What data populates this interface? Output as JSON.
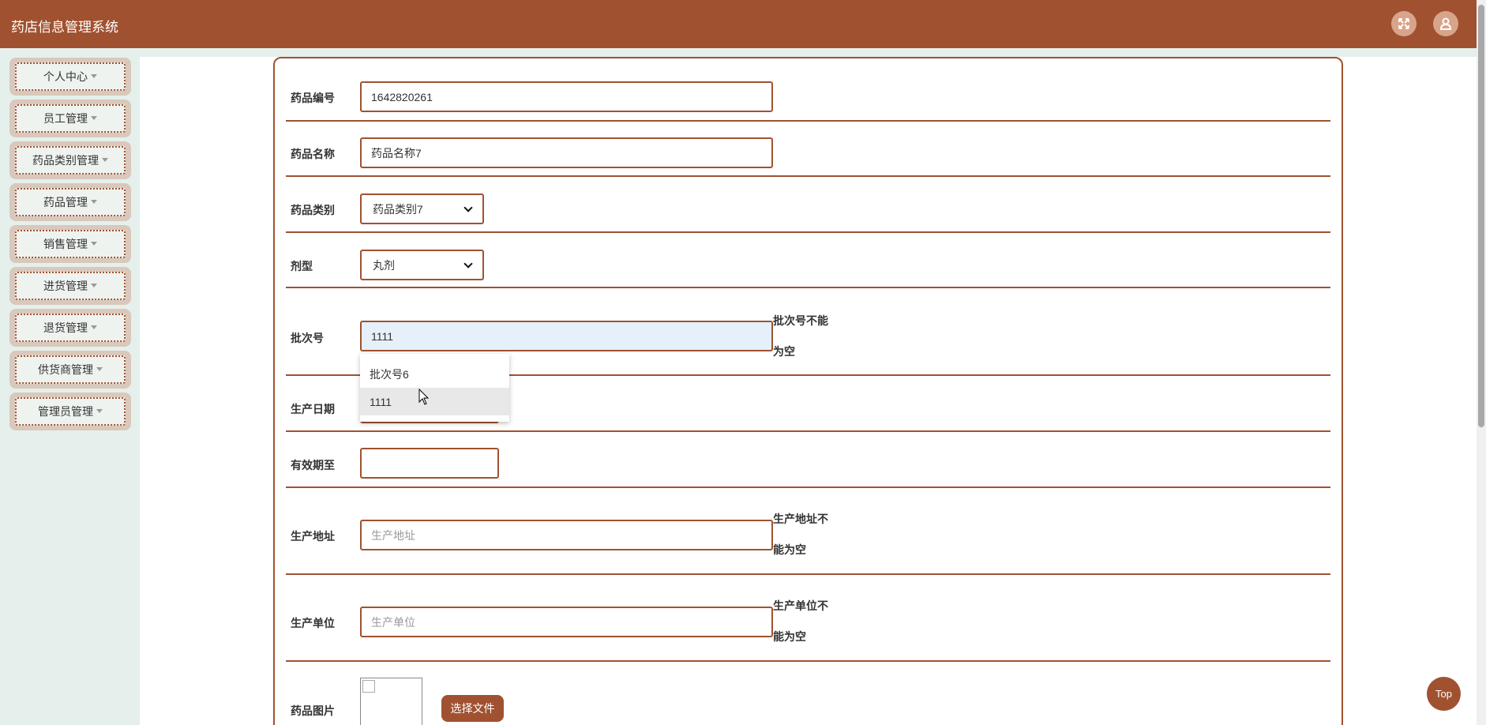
{
  "header": {
    "title": "药店信息管理系统",
    "fullscreen_icon": "expand-icon",
    "user_icon": "user-icon"
  },
  "sidebar": {
    "items": [
      {
        "label": "个人中心"
      },
      {
        "label": "员工管理"
      },
      {
        "label": "药品类别管理"
      },
      {
        "label": "药品管理"
      },
      {
        "label": "销售管理"
      },
      {
        "label": "进货管理"
      },
      {
        "label": "退货管理"
      },
      {
        "label": "供货商管理"
      },
      {
        "label": "管理员管理"
      }
    ]
  },
  "form": {
    "drug_no": {
      "label": "药品编号",
      "value": "1642820261"
    },
    "drug_name": {
      "label": "药品名称",
      "value": "药品名称7"
    },
    "drug_category": {
      "label": "药品类别",
      "value": "药品类别7"
    },
    "dosage_form": {
      "label": "剂型",
      "value": "丸剂"
    },
    "batch_no": {
      "label": "批次号",
      "value": "1111",
      "error_line1": "批次号不能",
      "error_line2": "为空"
    },
    "batch_suggestions": [
      "批次号6",
      "1111"
    ],
    "production_date": {
      "label": "生产日期"
    },
    "expiry_date": {
      "label": "有效期至"
    },
    "production_address": {
      "label": "生产地址",
      "placeholder": "生产地址",
      "error_line1": "生产地址不",
      "error_line2": "能为空"
    },
    "manufacturer": {
      "label": "生产单位",
      "placeholder": "生产单位",
      "error_line1": "生产单位不",
      "error_line2": "能为空"
    },
    "drug_image": {
      "label": "药品图片",
      "button": "选择文件"
    }
  },
  "top_button": "Top",
  "colors": {
    "brand": "#a05230",
    "sidebar_bg": "#e5f0ec",
    "active_input": "#e6f0fa"
  }
}
